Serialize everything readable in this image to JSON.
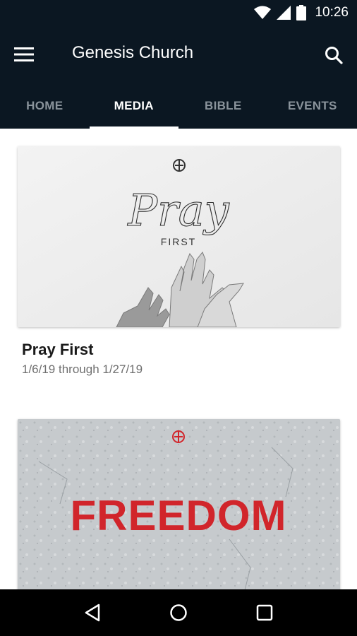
{
  "status_bar": {
    "time": "10:26"
  },
  "app_bar": {
    "title": "Genesis Church"
  },
  "tabs": [
    {
      "label": "HOME",
      "active": false
    },
    {
      "label": "MEDIA",
      "active": true
    },
    {
      "label": "BIBLE",
      "active": false
    },
    {
      "label": "EVENTS",
      "active": false
    }
  ],
  "media": [
    {
      "art_script_word": "Pray",
      "art_caption": "FIRST",
      "title": "Pray First",
      "dates": "1/6/19 through 1/27/19"
    },
    {
      "art_word": "FREEDOM"
    }
  ],
  "colors": {
    "app_bar_bg": "#0b1722",
    "tab_inactive": "#8a939b",
    "tab_active": "#ffffff",
    "freedom_red": "#d1252b"
  },
  "icons": {
    "menu": "menu-icon",
    "search": "search-icon",
    "wifi": "wifi-icon",
    "signal": "signal-icon",
    "battery": "battery-icon",
    "back": "back-icon",
    "home": "home-icon",
    "recents": "recents-icon",
    "logo": "genesis-logo-icon"
  }
}
